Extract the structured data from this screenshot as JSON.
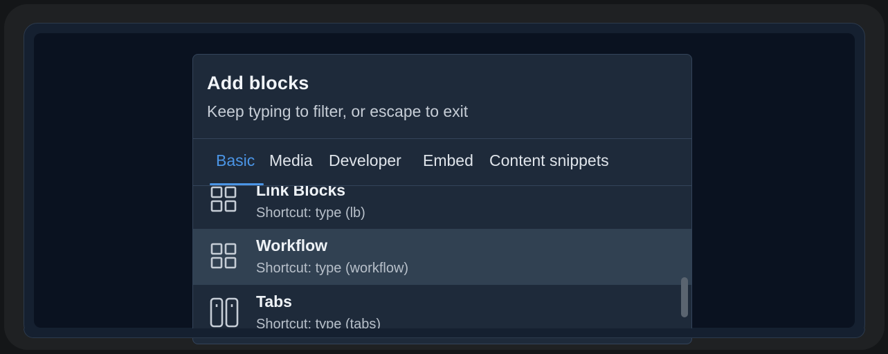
{
  "dialog": {
    "title": "Add blocks",
    "subtitle": "Keep typing to filter, or escape to exit"
  },
  "tabs": [
    {
      "label": "Basic",
      "active": true
    },
    {
      "label": "Media",
      "active": false
    },
    {
      "label": "Developer",
      "active": false
    },
    {
      "label": "Embed",
      "active": false
    },
    {
      "label": "Content snippets",
      "active": false
    }
  ],
  "blocks": [
    {
      "name": "Link Blocks",
      "shortcut": "Shortcut: type (lb)",
      "icon": "grid-icon"
    },
    {
      "name": "Workflow",
      "shortcut": "Shortcut: type (workflow)",
      "icon": "grid-icon",
      "selected": true
    },
    {
      "name": "Tabs",
      "shortcut": "Shortcut: type (tabs)",
      "icon": "columns-icon"
    }
  ],
  "colors": {
    "accent": "#4b95e6",
    "dialog_bg": "#1e2a3a",
    "selected_bg": "#314152"
  }
}
